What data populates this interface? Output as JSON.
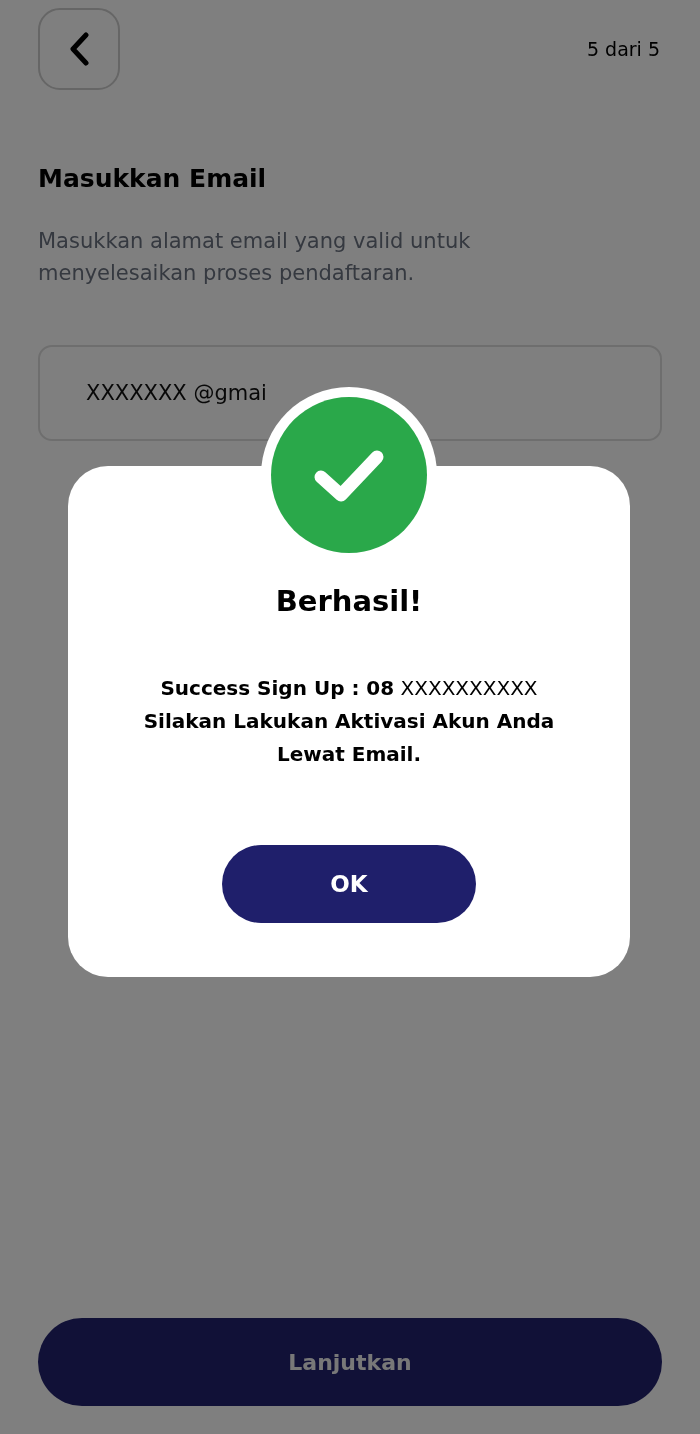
{
  "header": {
    "step": "5 dari 5"
  },
  "title": "Masukkan Email",
  "subtitle": "Masukkan alamat email yang valid untuk menyelesaikan proses pendaftaran.",
  "email_field": {
    "value": "XXXXXXX @gmai"
  },
  "continue_button": {
    "label": "Lanjutkan"
  },
  "dialog": {
    "title": "Berhasil!",
    "message": "**Success Sign Up : 08** XXXXXXXXXX **Silakan Lakukan Aktivasi Akun Anda Lewat Email.**",
    "button": "OK"
  }
}
